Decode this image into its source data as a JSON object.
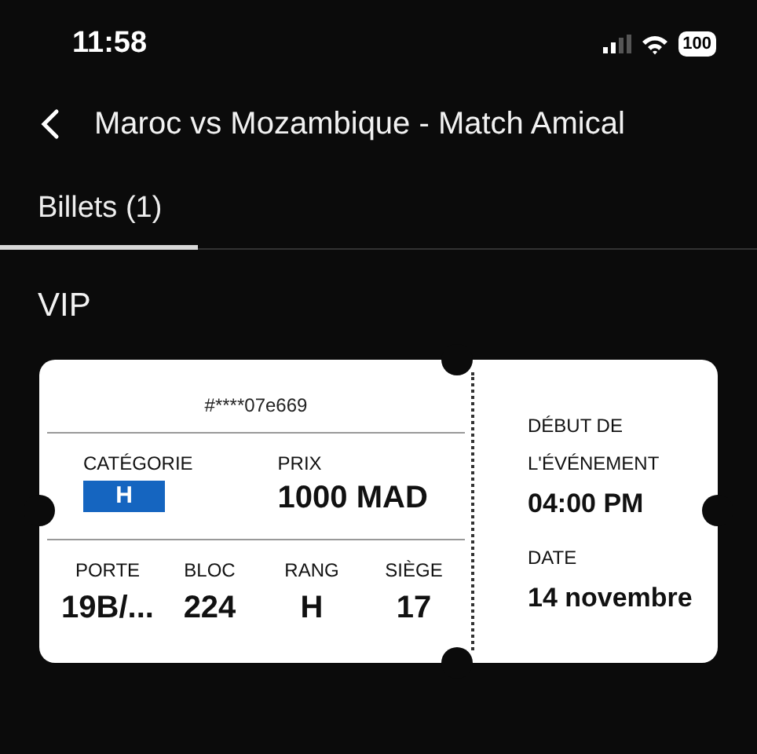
{
  "status_bar": {
    "time": "11:58",
    "battery": "100"
  },
  "header": {
    "title": "Maroc vs Mozambique - Match Amical"
  },
  "tabs": [
    {
      "label": "Billets (1)",
      "selected": true
    }
  ],
  "section_title": "VIP",
  "ticket": {
    "number": "#****07e669",
    "category": {
      "label": "CATÉGORIE",
      "value": "H",
      "color": "#1565c0"
    },
    "price": {
      "label": "PRIX",
      "value": "1000 MAD"
    },
    "details": [
      {
        "label": "PORTE",
        "value": "19B/..."
      },
      {
        "label": "BLOC",
        "value": "224"
      },
      {
        "label": "RANG",
        "value": "H"
      },
      {
        "label": "SIÈGE",
        "value": "17"
      }
    ],
    "start": {
      "label_lines": [
        "DÉBUT DE",
        "L'ÉVÉNEMENT"
      ],
      "value": "04:00 PM"
    },
    "date": {
      "label": "DATE",
      "value": "14 novembre"
    }
  }
}
